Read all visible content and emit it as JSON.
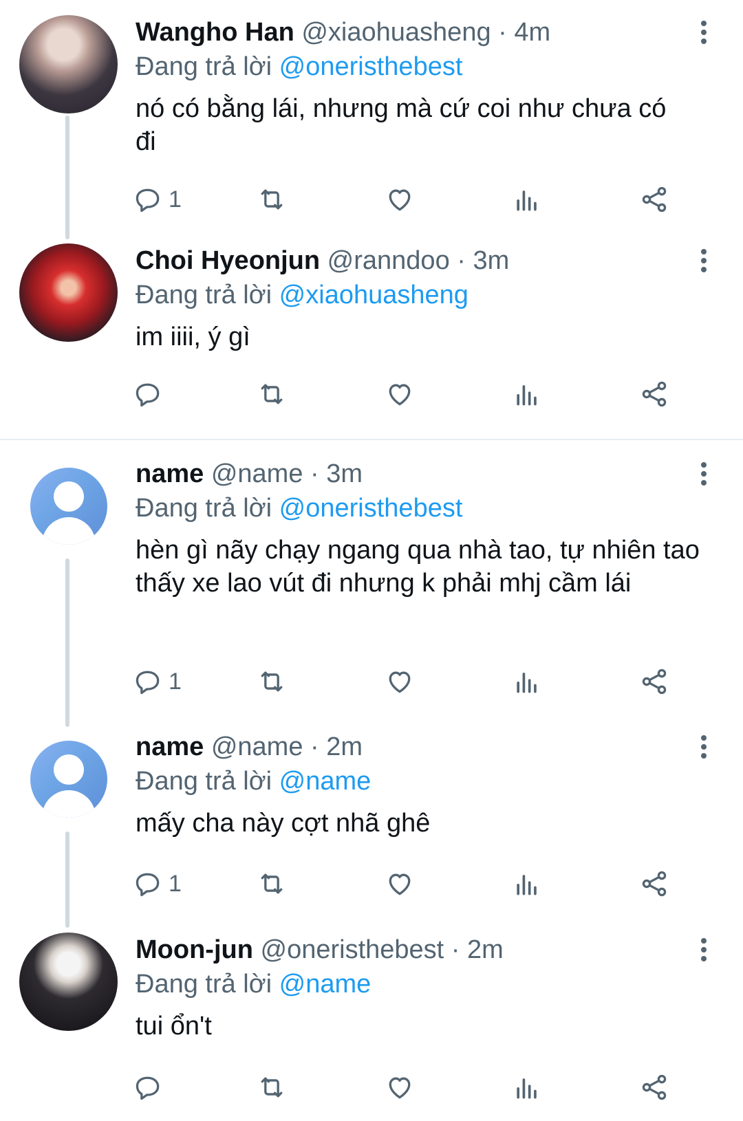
{
  "tweets": [
    {
      "name": "Wangho Han",
      "handle": "@xiaohuasheng",
      "dot": "·",
      "time": "4m",
      "reply_prefix": "Đang trả lời",
      "reply_to": "@oneristhebest",
      "text": "nó có bằng lái, nhưng mà cứ coi như chưa có đi",
      "reply_count": "1"
    },
    {
      "name": "Choi Hyeonjun",
      "handle": "@ranndoo",
      "dot": "·",
      "time": "3m",
      "reply_prefix": "Đang trả lời",
      "reply_to": "@xiaohuasheng",
      "text": "im iiii, ý gì",
      "reply_count": ""
    },
    {
      "name": "name",
      "handle": "@name",
      "dot": "·",
      "time": "3m",
      "reply_prefix": "Đang trả lời",
      "reply_to": "@oneristhebest",
      "text": "hèn gì nãy chạy ngang qua nhà tao, tự nhiên tao thấy xe lao vút đi nhưng k phải mhj cầm lái",
      "reply_count": "1"
    },
    {
      "name": "name",
      "handle": "@name",
      "dot": "·",
      "time": "2m",
      "reply_prefix": "Đang trả lời",
      "reply_to": "@name",
      "text": "mấy cha này cợt nhã ghê",
      "reply_count": "1"
    },
    {
      "name": "Moon-jun",
      "handle": "@oneristhebest",
      "dot": "·",
      "time": "2m",
      "reply_prefix": "Đang trả lời",
      "reply_to": "@name",
      "text": "tui ổn't",
      "reply_count": ""
    }
  ],
  "icons": [
    "reply-icon",
    "retweet-icon",
    "like-icon",
    "views-icon",
    "share-icon",
    "more-icon"
  ],
  "colors": {
    "text": "#0f1419",
    "secondary": "#536471",
    "link": "#1d9bf0",
    "thread_line": "#cfd9de",
    "divider": "#e6ecf0"
  }
}
